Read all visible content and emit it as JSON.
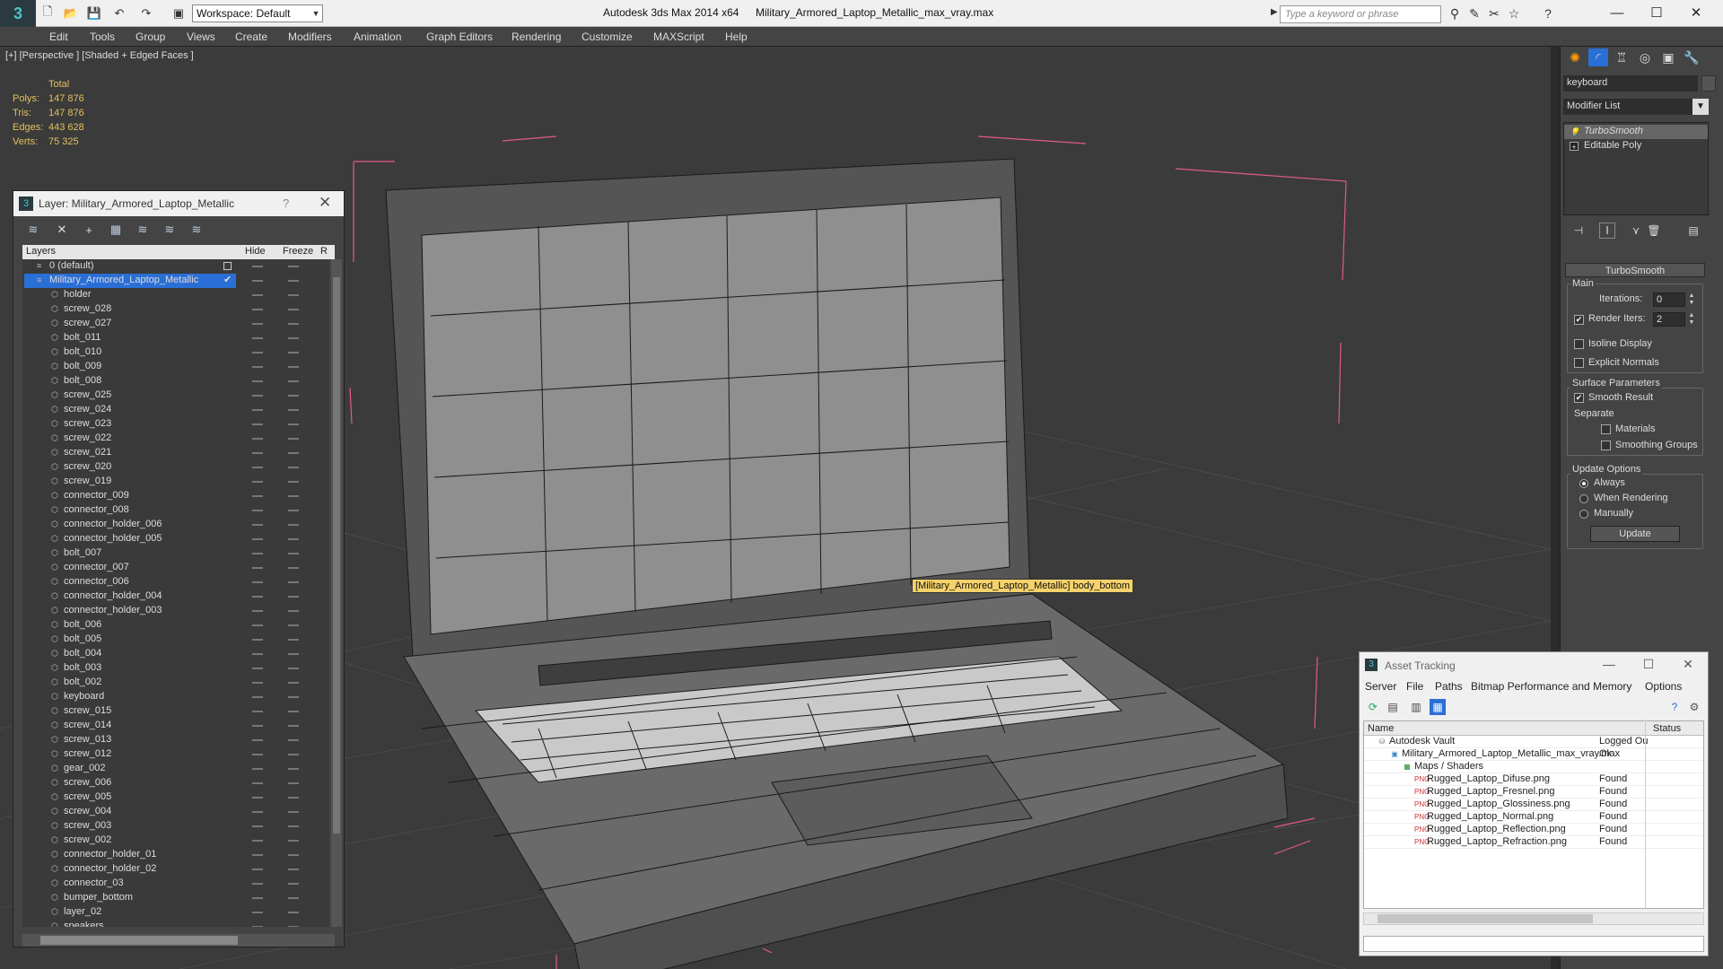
{
  "app": {
    "title": "Autodesk 3ds Max  2014 x64",
    "file": "Military_Armored_Laptop_Metallic_max_vray.max",
    "workspace": "Workspace: Default",
    "search_placeholder": "Type a keyword or phrase",
    "logo_icon": "3dsmax-logo-icon"
  },
  "menu": [
    "Edit",
    "Tools",
    "Group",
    "Views",
    "Create",
    "Modifiers",
    "Animation",
    "Graph Editors",
    "Rendering",
    "Customize",
    "MAXScript",
    "Help"
  ],
  "viewport": {
    "label": "[+] [Perspective ] [Shaded + Edged Faces ]",
    "stats": {
      "header": "Total",
      "rows": [
        {
          "label": "Polys:",
          "value": "147 876"
        },
        {
          "label": "Tris:",
          "value": "147 876"
        },
        {
          "label": "Edges:",
          "value": "443 628"
        },
        {
          "label": "Verts:",
          "value": "75 325"
        }
      ]
    },
    "tooltip": "[Military_Armored_Laptop_Metallic] body_bottom"
  },
  "layer_panel": {
    "title": "Layer: Military_Armored_Laptop_Metallic",
    "help": "?",
    "close": "✕",
    "columns": {
      "layers": "Layers",
      "hide": "Hide",
      "freeze": "Freeze",
      "render": "R"
    },
    "rows": [
      {
        "name": "0 (default)",
        "type": "layer"
      },
      {
        "name": "Military_Armored_Laptop_Metallic",
        "type": "layer-active"
      },
      {
        "name": "holder"
      },
      {
        "name": "screw_028"
      },
      {
        "name": "screw_027"
      },
      {
        "name": "bolt_011"
      },
      {
        "name": "bolt_010"
      },
      {
        "name": "bolt_009"
      },
      {
        "name": "bolt_008"
      },
      {
        "name": "screw_025"
      },
      {
        "name": "screw_024"
      },
      {
        "name": "screw_023"
      },
      {
        "name": "screw_022"
      },
      {
        "name": "screw_021"
      },
      {
        "name": "screw_020"
      },
      {
        "name": "screw_019"
      },
      {
        "name": "connector_009"
      },
      {
        "name": "connector_008"
      },
      {
        "name": "connector_holder_006"
      },
      {
        "name": "connector_holder_005"
      },
      {
        "name": "bolt_007"
      },
      {
        "name": "connector_007"
      },
      {
        "name": "connector_006"
      },
      {
        "name": "connector_holder_004"
      },
      {
        "name": "connector_holder_003"
      },
      {
        "name": "bolt_006"
      },
      {
        "name": "bolt_005"
      },
      {
        "name": "bolt_004"
      },
      {
        "name": "bolt_003"
      },
      {
        "name": "bolt_002"
      },
      {
        "name": "keyboard"
      },
      {
        "name": "screw_015"
      },
      {
        "name": "screw_014"
      },
      {
        "name": "screw_013"
      },
      {
        "name": "screw_012"
      },
      {
        "name": "gear_002"
      },
      {
        "name": "screw_006"
      },
      {
        "name": "screw_005"
      },
      {
        "name": "screw_004"
      },
      {
        "name": "screw_003"
      },
      {
        "name": "screw_002"
      },
      {
        "name": "connector_holder_01"
      },
      {
        "name": "connector_holder_02"
      },
      {
        "name": "connector_03"
      },
      {
        "name": "bumper_bottom"
      },
      {
        "name": "layer_02"
      },
      {
        "name": "speakers"
      }
    ]
  },
  "command_panel": {
    "object_name": "keyboard",
    "modifier_list": "Modifier List",
    "stack": [
      {
        "name": "TurboSmooth",
        "italic": true
      },
      {
        "name": "Editable Poly",
        "italic": false
      }
    ],
    "rollout_title": "TurboSmooth",
    "main_label": "Main",
    "iterations_label": "Iterations:",
    "iterations_value": "0",
    "render_iters_label": "Render Iters:",
    "render_iters_value": "2",
    "isoline_label": "Isoline Display",
    "explicit_normals_label": "Explicit Normals",
    "surface_params_label": "Surface Parameters",
    "smooth_result_label": "Smooth Result",
    "separate_label": "Separate",
    "materials_label": "Materials",
    "smoothing_groups_label": "Smoothing Groups",
    "update_options_label": "Update Options",
    "always_label": "Always",
    "when_rendering_label": "When Rendering",
    "manually_label": "Manually",
    "update_button": "Update"
  },
  "asset_tracking": {
    "title": "Asset Tracking",
    "menu": [
      "Server",
      "File",
      "Paths",
      "Bitmap Performance and Memory",
      "Options"
    ],
    "columns": {
      "name": "Name",
      "status": "Status"
    },
    "rows": [
      {
        "name": "Autodesk Vault",
        "status": "Logged Ou",
        "indent": 0,
        "icon": "vault-icon"
      },
      {
        "name": "Military_Armored_Laptop_Metallic_max_vray.max",
        "status": "Ok",
        "indent": 1,
        "icon": "max-file-icon"
      },
      {
        "name": "Maps / Shaders",
        "status": "",
        "indent": 2,
        "icon": "maps-folder-icon"
      },
      {
        "name": "Rugged_Laptop_Difuse.png",
        "status": "Found",
        "indent": 3,
        "icon": "png-file-icon"
      },
      {
        "name": "Rugged_Laptop_Fresnel.png",
        "status": "Found",
        "indent": 3,
        "icon": "png-file-icon"
      },
      {
        "name": "Rugged_Laptop_Glossiness.png",
        "status": "Found",
        "indent": 3,
        "icon": "png-file-icon"
      },
      {
        "name": "Rugged_Laptop_Normal.png",
        "status": "Found",
        "indent": 3,
        "icon": "png-file-icon"
      },
      {
        "name": "Rugged_Laptop_Reflection.png",
        "status": "Found",
        "indent": 3,
        "icon": "png-file-icon"
      },
      {
        "name": "Rugged_Laptop_Refraction.png",
        "status": "Found",
        "indent": 3,
        "icon": "png-file-icon"
      }
    ]
  },
  "colors": {
    "viewport_bg": "#3b3b3b",
    "stats": "#e4c05c",
    "selection": "#2a6fd6",
    "bounding_box": "#e05a8a",
    "tooltip_bg": "#f5d26b"
  }
}
